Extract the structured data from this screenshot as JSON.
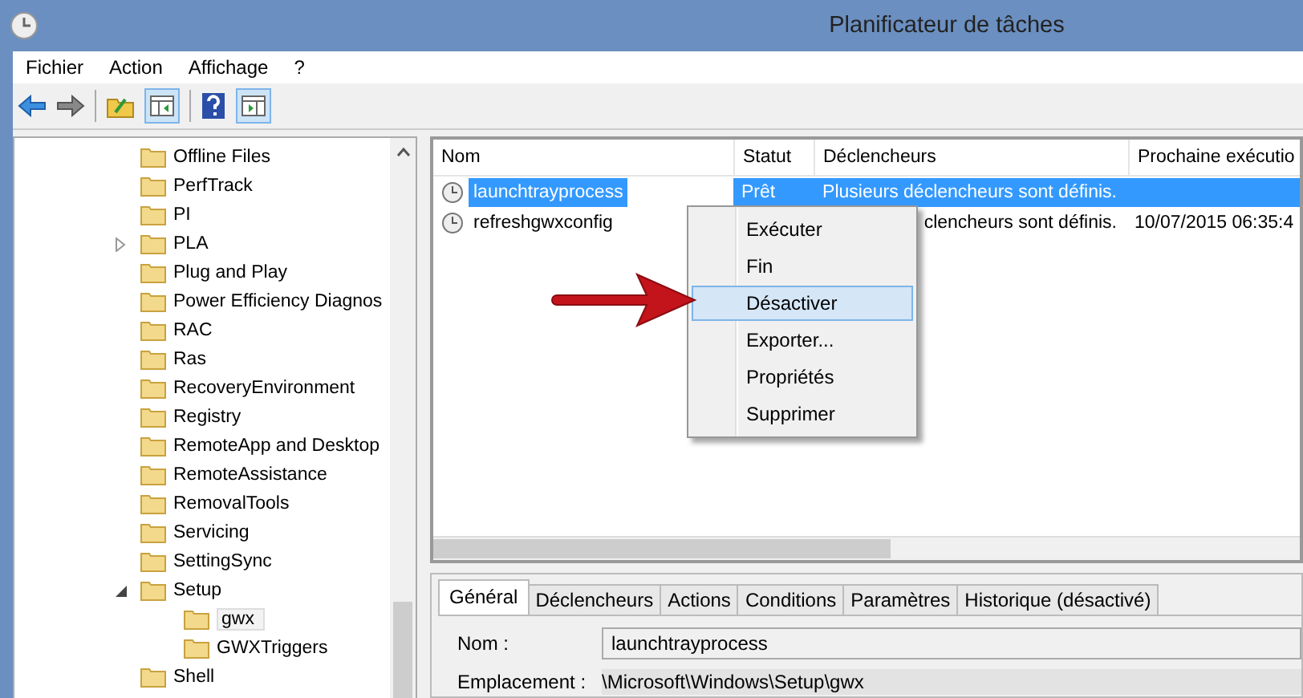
{
  "window": {
    "title": "Planificateur de tâches"
  },
  "menu": [
    "Fichier",
    "Action",
    "Affichage",
    "?"
  ],
  "tree": [
    {
      "label": "Offline Files"
    },
    {
      "label": "PerfTrack"
    },
    {
      "label": "PI"
    },
    {
      "label": "PLA",
      "expanded": false
    },
    {
      "label": "Plug and Play"
    },
    {
      "label": "Power Efficiency Diagnos"
    },
    {
      "label": "RAC"
    },
    {
      "label": "Ras"
    },
    {
      "label": "RecoveryEnvironment"
    },
    {
      "label": "Registry"
    },
    {
      "label": "RemoteApp and Desktop"
    },
    {
      "label": "RemoteAssistance"
    },
    {
      "label": "RemovalTools"
    },
    {
      "label": "Servicing"
    },
    {
      "label": "SettingSync"
    },
    {
      "label": "Setup",
      "expanded": true,
      "children": [
        {
          "label": "gwx",
          "selected": true
        },
        {
          "label": "GWXTriggers",
          "selected": false
        }
      ]
    },
    {
      "label": "Shell"
    }
  ],
  "task_list": {
    "columns": [
      "Nom",
      "Statut",
      "Déclencheurs",
      "Prochaine exécutio"
    ],
    "rows": [
      {
        "name": "launchtrayprocess",
        "status": "Prêt",
        "triggers": "Plusieurs déclencheurs sont définis.",
        "selected": true
      },
      {
        "name": "refreshgwxconfig",
        "triggers": "clencheurs sont définis.",
        "next_run": "10/07/2015 06:35:4",
        "selected": false
      }
    ]
  },
  "context_menu": [
    {
      "label": "Exécuter",
      "selected": false
    },
    {
      "label": "Fin",
      "selected": false
    },
    {
      "label": "Désactiver",
      "selected": true
    },
    {
      "label": "Exporter...",
      "selected": false
    },
    {
      "label": "Propriétés",
      "selected": false
    },
    {
      "label": "Supprimer",
      "selected": false
    }
  ],
  "detail_tabs": [
    {
      "label": "Général",
      "selected": true
    },
    {
      "label": "Déclencheurs",
      "selected": false
    },
    {
      "label": "Actions",
      "selected": false
    },
    {
      "label": "Conditions",
      "selected": false
    },
    {
      "label": "Paramètres",
      "selected": false
    },
    {
      "label": "Historique (désactivé)",
      "selected": false
    }
  ],
  "general": {
    "name_label": "Nom :",
    "name_value": "launchtrayprocess",
    "location_label": "Emplacement :",
    "location_value": "\\Microsoft\\Windows\\Setup\\gwx"
  }
}
